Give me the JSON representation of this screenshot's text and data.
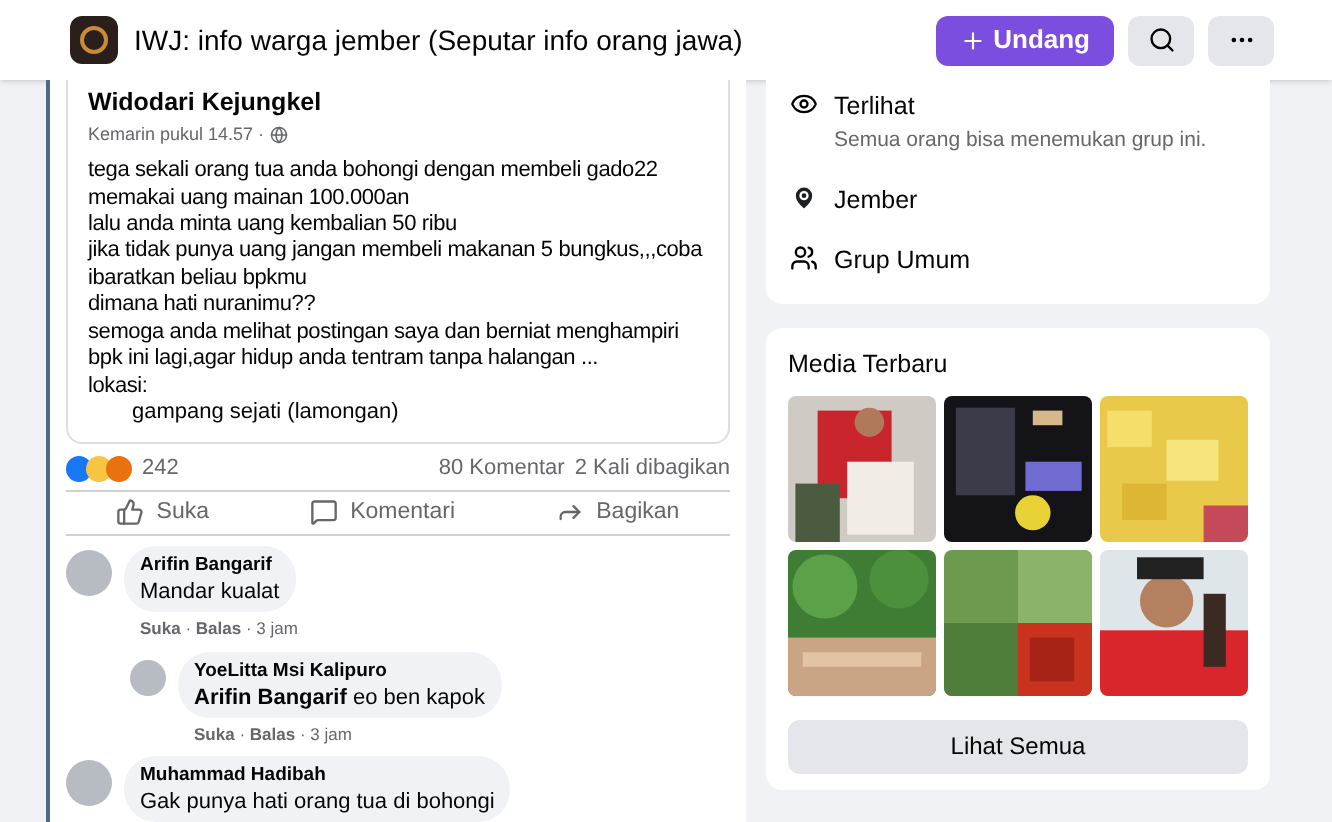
{
  "header": {
    "title": "IWJ: info warga jember (Seputar info orang jawa)",
    "buttons": [
      {
        "kind": "invite",
        "label": "Undang"
      },
      {
        "kind": "search"
      },
      {
        "kind": "more"
      }
    ]
  },
  "post": {
    "author": "Widodari Kejungkel",
    "time": "Kemarin pukul 14.57 ·",
    "body": [
      "tega sekali orang tua anda bohongi dengan membeli gado22",
      "memakai uang mainan 100.000an",
      "lalu anda minta uang kembalian 50 ribu",
      "jika tidak punya uang jangan membeli makanan 5 bungkus,,,coba ibaratkan beliau bpkmu",
      "dimana hati nuranimu??",
      "semoga anda melihat postingan saya dan berniat menghampiri bpk ini lagi,agar hidup anda tentram tanpa halangan ...",
      "lokasi:"
    ],
    "location": "gampang sejati (lamongan)"
  },
  "stats": {
    "reactions": "242",
    "comments": "80 Komentar",
    "shares": "2 Kali dibagikan"
  },
  "actions": [
    {
      "kind": "like",
      "label": "Suka"
    },
    {
      "kind": "comment",
      "label": "Komentari"
    },
    {
      "kind": "share",
      "label": "Bagikan"
    }
  ],
  "comments": [
    {
      "author": "Arifin Bangarif",
      "text": "Mandar kualat",
      "meta": "**Suka** · **Balas** · 3 jam",
      "replies": [
        {
          "author": "YoeLitta Msi Kalipuro",
          "mention": "Arifin Bangarif",
          "text": "eo ben kapok",
          "meta": "**Suka** · **Balas** · 3 jam"
        }
      ]
    },
    {
      "author": "Muhammad Hadibah",
      "text": "Gak punya hati orang tua di bohongi"
    }
  ],
  "about": [
    {
      "kind": "visible",
      "title": "Terlihat",
      "subtitle": "Semua orang bisa menemukan grup ini."
    },
    {
      "kind": "location",
      "title": "Jember"
    },
    {
      "kind": "group",
      "title": "Grup Umum"
    }
  ],
  "media": {
    "title": "Media Terbaru",
    "button": "Lihat Semua"
  }
}
